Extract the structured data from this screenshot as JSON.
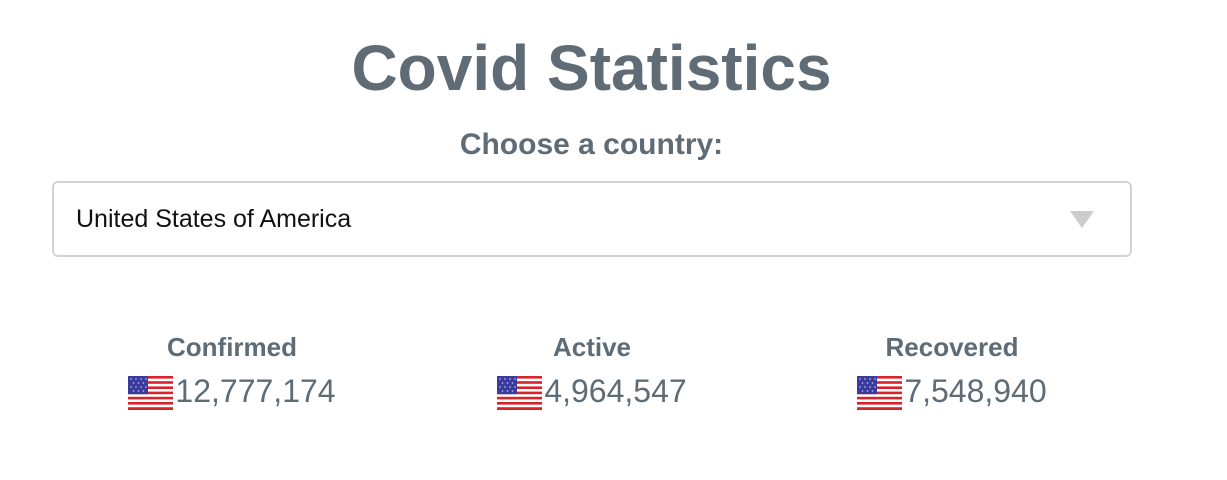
{
  "page": {
    "title": "Covid Statistics",
    "choose_label": "Choose a country:"
  },
  "country_select": {
    "selected": "United States of America",
    "caret_icon": "chevron-down-icon"
  },
  "stats": [
    {
      "label": "Confirmed",
      "value": "12,777,174",
      "flag_icon": "us-flag-icon"
    },
    {
      "label": "Active",
      "value": "4,964,547",
      "flag_icon": "us-flag-icon"
    },
    {
      "label": "Recovered",
      "value": "7,548,940",
      "flag_icon": "us-flag-icon"
    }
  ],
  "colors": {
    "text": "#5f6b75",
    "select_border": "#d3d3d3",
    "caret": "#cccccc",
    "flag_red": "#d8232a",
    "flag_blue": "#3b3b9e"
  }
}
